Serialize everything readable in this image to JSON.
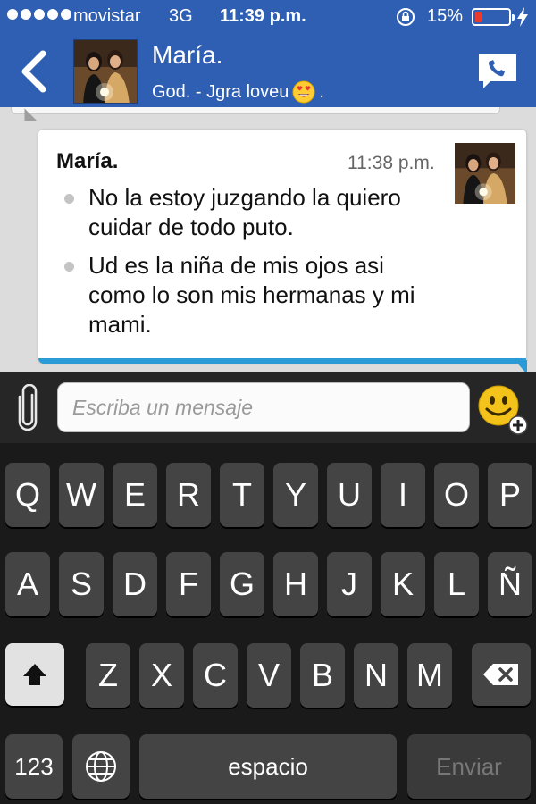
{
  "status_bar": {
    "carrier": "movistar",
    "network": "3G",
    "time": "11:39 p.m.",
    "battery_pct": "15%",
    "battery_level": 0.15,
    "battery_color": "#e83a2f",
    "icons": [
      "signal-dots-icon",
      "rotation-lock-icon",
      "battery-icon",
      "charging-bolt-icon"
    ]
  },
  "header": {
    "contact_name": "María.",
    "contact_status": "God. - Jgra loveu",
    "status_emoji": "😍",
    "status_suffix": ".",
    "back_icon": "chevron-left-icon",
    "call_icon": "phone-bubble-icon",
    "bar_color": "#2f5fb3"
  },
  "chat": {
    "message": {
      "sender": "María.",
      "time": "11:38 p.m.",
      "lines": [
        "No la estoy juzgando la quiero cuidar de todo puto.",
        "Ud es la niña de mis ojos asi como lo son mis hermanas y mi mami."
      ],
      "accent_color": "#2b9bd8"
    }
  },
  "composer": {
    "placeholder": "Escriba un mensaje",
    "attach_icon": "paperclip-icon",
    "emoji_icon": "smiley-add-icon"
  },
  "keyboard": {
    "row1": [
      "Q",
      "W",
      "E",
      "R",
      "T",
      "Y",
      "U",
      "I",
      "O",
      "P"
    ],
    "row2": [
      "A",
      "S",
      "D",
      "F",
      "G",
      "H",
      "J",
      "K",
      "L",
      "Ñ"
    ],
    "row3": [
      "Z",
      "X",
      "C",
      "V",
      "B",
      "N",
      "M"
    ],
    "numbers_label": "123",
    "space_label": "espacio",
    "send_label": "Enviar"
  }
}
